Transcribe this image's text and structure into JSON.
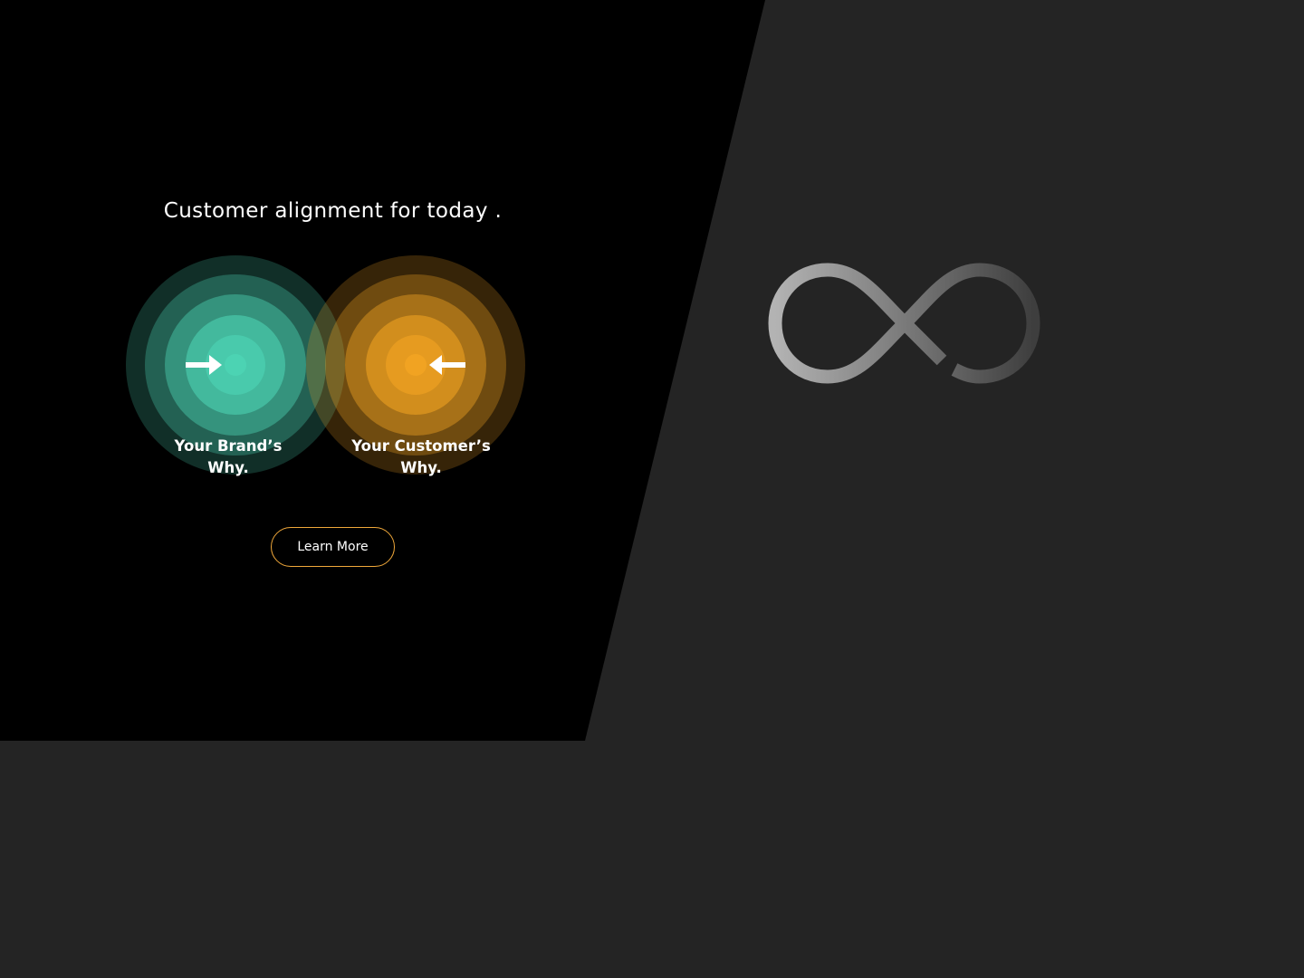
{
  "hero": {
    "headline": "Customer alignment for today .",
    "brand_label": "Your Brand’s Why.",
    "customer_label": "Your Customer’s Why.",
    "cta_label": "Learn More"
  },
  "colors": {
    "left_background": "#000000",
    "page_background": "#242424",
    "brand_accent": "#4fd8b8",
    "customer_accent": "#f5a623",
    "cta_border": "#f0a83a"
  },
  "icons": {
    "brand_arrow": "arrow-right-icon",
    "customer_arrow": "arrow-left-icon",
    "logo": "infinity-logo-icon"
  }
}
